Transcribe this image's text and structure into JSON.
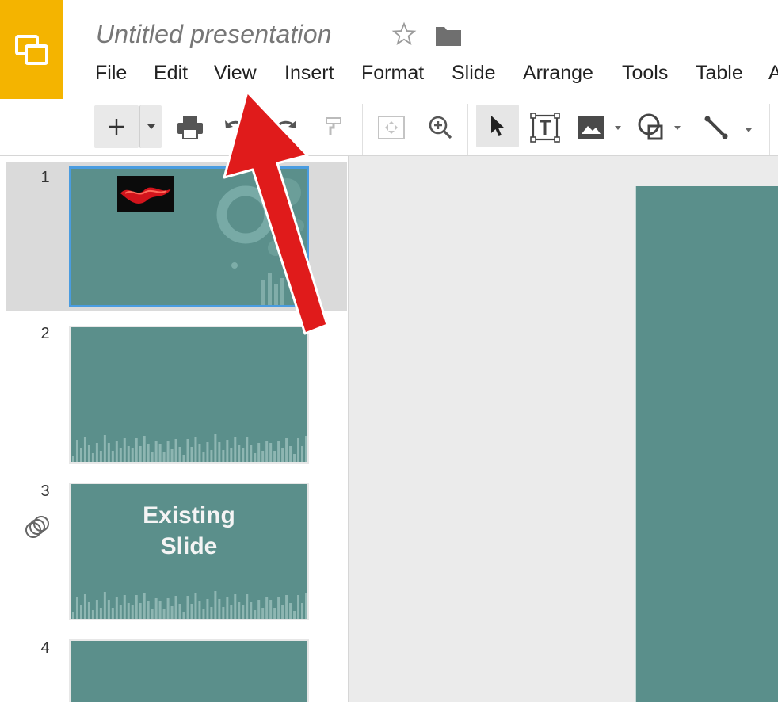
{
  "app": {
    "title": "Untitled presentation",
    "logo_icon": "slides-logo-icon",
    "brand_color": "#f4b400"
  },
  "menu": [
    {
      "label": "File"
    },
    {
      "label": "Edit"
    },
    {
      "label": "View"
    },
    {
      "label": "Insert"
    },
    {
      "label": "Format"
    },
    {
      "label": "Slide"
    },
    {
      "label": "Arrange"
    },
    {
      "label": "Tools"
    },
    {
      "label": "Table"
    },
    {
      "label": "A"
    }
  ],
  "toolbar": {
    "icons": [
      "plus-icon",
      "caret-down-icon",
      "print-icon",
      "undo-icon",
      "redo-icon",
      "paint-format-icon",
      "zoom-fit-icon",
      "zoom-in-icon",
      "select-cursor-icon",
      "text-box-icon",
      "image-icon",
      "shape-icon",
      "line-icon"
    ]
  },
  "slides": [
    {
      "number": "1",
      "title": "",
      "selected": true
    },
    {
      "number": "2",
      "title": "",
      "selected": false
    },
    {
      "number": "3",
      "title_line1": "Existing",
      "title_line2": "Slide",
      "selected": false,
      "has_transition_icon": true
    },
    {
      "number": "4",
      "title": "",
      "selected": false
    }
  ],
  "colors": {
    "slide_background": "#5b8f8b",
    "selection_border": "#4a9ce0",
    "annotation_arrow": "#e01b1b"
  }
}
